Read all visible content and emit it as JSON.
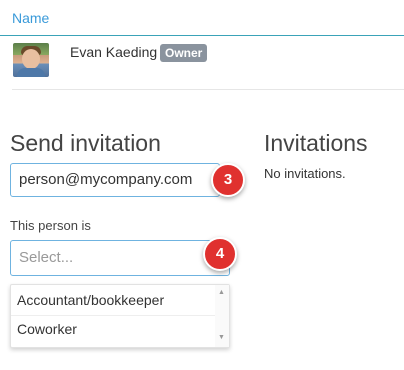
{
  "members_table": {
    "column_header": "Name",
    "rows": [
      {
        "name": "Evan Kaeding",
        "role_badge": "Owner"
      }
    ]
  },
  "send_invitation": {
    "title": "Send invitation",
    "email_value": "person@mycompany.com",
    "role_label": "This person is",
    "role_select_placeholder": "Select...",
    "role_options": [
      "Accountant/bookkeeper",
      "Coworker"
    ]
  },
  "invitations": {
    "title": "Invitations",
    "empty_text": "No invitations."
  },
  "step_markers": [
    {
      "number": "3"
    },
    {
      "number": "4"
    }
  ],
  "colors": {
    "accent": "#3a9ad9",
    "header_rule": "#3aa3b8",
    "badge_bg": "#8a939e",
    "step_marker": "#e0312f",
    "input_border": "#6fb3e0"
  }
}
